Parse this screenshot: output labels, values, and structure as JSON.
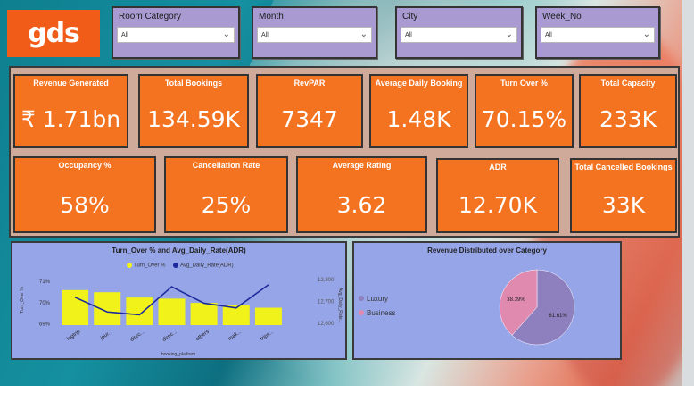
{
  "logo": {
    "text": "gds"
  },
  "slicers": [
    {
      "label": "Room Category",
      "value": "All"
    },
    {
      "label": "Month",
      "value": "All"
    },
    {
      "label": "City",
      "value": "All"
    },
    {
      "label": "Week_No",
      "value": "All"
    }
  ],
  "kpis": [
    {
      "title": "Revenue Generated",
      "value": "₹ 1.71bn"
    },
    {
      "title": "Total Bookings",
      "value": "134.59K"
    },
    {
      "title": "RevPAR",
      "value": "7347"
    },
    {
      "title": "Average Daily Booking",
      "value": "1.48K"
    },
    {
      "title": "Turn Over %",
      "value": "70.15%"
    },
    {
      "title": "Total Capacity",
      "value": "233K"
    },
    {
      "title": "Occupancy %",
      "value": "58%"
    },
    {
      "title": "Cancellation Rate",
      "value": "25%"
    },
    {
      "title": "Average Rating",
      "value": "3.62"
    },
    {
      "title": "ADR",
      "value": "12.70K"
    },
    {
      "title": "Total Cancelled Bookings",
      "value": "33K"
    }
  ],
  "colors": {
    "kpi": "#f47321",
    "bar": "#f0f21a",
    "line": "#1c2a9c",
    "luxury": "#8e7fbf",
    "business": "#e08ab0",
    "panel": "#96a5e8"
  },
  "chart_data": [
    {
      "type": "bar",
      "title": "Turn_Over % and Avg_Daily_Rate(ADR)",
      "xlabel": "booking_platform",
      "ylabel": "Turn_Over %",
      "y2label": "Avg_Daily_Rate...",
      "categories": [
        "logtrip",
        "jour...",
        "direc...",
        "direc...",
        "others",
        "mak...",
        "trips..."
      ],
      "y_ticks": [
        "71%",
        "70%",
        "69%"
      ],
      "y2_ticks": [
        "12,800",
        "12,700",
        "12,600"
      ],
      "ylim": [
        68.9,
        71.3
      ],
      "y2lim": [
        12600,
        12800
      ],
      "series": [
        {
          "name": "Turn_Over %",
          "type": "bar",
          "values": [
            70.55,
            70.45,
            70.2,
            70.15,
            69.95,
            69.85,
            69.72
          ]
        },
        {
          "name": "Avg_Daily_Rate(ADR)",
          "type": "line",
          "values": [
            12715,
            12648,
            12635,
            12763,
            12688,
            12666,
            12772
          ]
        }
      ],
      "legend": "top"
    },
    {
      "type": "pie",
      "title": "Revenue Distributed over Category",
      "labels": [
        "Luxury",
        "Business"
      ],
      "values": [
        61.61,
        38.39
      ],
      "data_labels": [
        "61.61%",
        "38.39%"
      ],
      "legend": "left"
    }
  ]
}
